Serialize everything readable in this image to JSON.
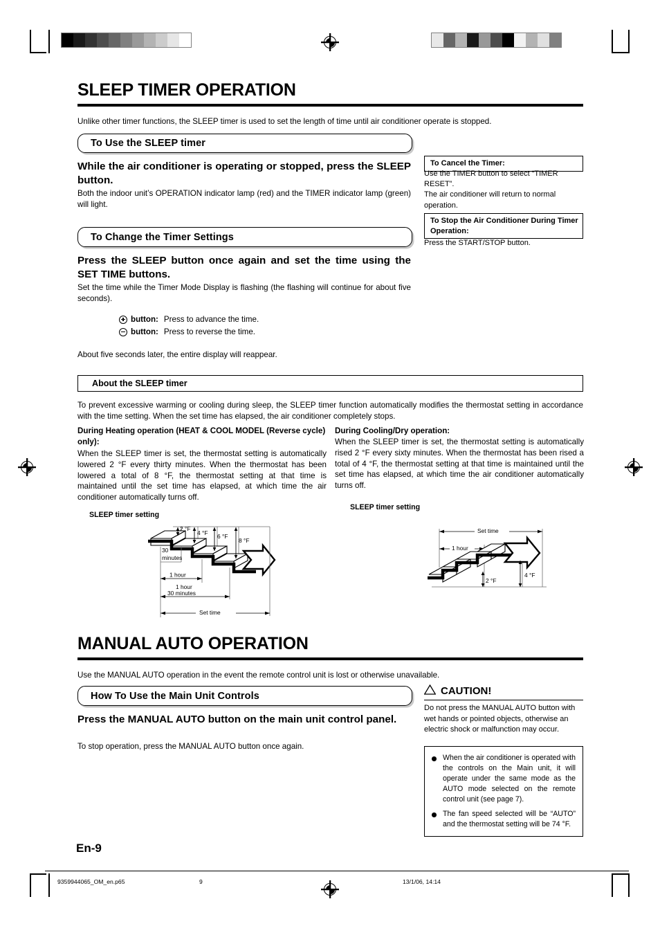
{
  "printer_marks": {
    "colorbar_left": [
      "#000000",
      "#1a1a1a",
      "#333333",
      "#4d4d4d",
      "#666666",
      "#808080",
      "#999999",
      "#b3b3b3",
      "#cccccc",
      "#e6e6e6",
      "#ffffff"
    ],
    "colorbar_right": [
      "#e8e8e8",
      "#666666",
      "#b3b3b3",
      "#1a1a1a",
      "#999999",
      "#4d4d4d",
      "#000000",
      "#f2f2f2",
      "#b3b3b3",
      "#e0e0e0",
      "#808080"
    ]
  },
  "section1": {
    "title": "SLEEP TIMER OPERATION",
    "intro": "Unlike other timer functions, the SLEEP timer is used to set the length of time until air conditioner operate is stopped.",
    "bar1_label": "To Use the SLEEP timer",
    "lead1": "While the air conditioner is operating or stopped, press the SLEEP button.",
    "body1": "Both the indoor unit’s OPERATION indicator lamp (red) and the TIMER indicator lamp (green) will light.",
    "bar2_label": "To Change the Timer Settings",
    "lead2": "Press the SLEEP button once again and set the time using the SET TIME buttons.",
    "body2": "Set the time while the Timer Mode Display is flashing (the flashing will continue for about five seconds).",
    "plus_button_label": "button:",
    "plus_button_desc": "Press to advance the time.",
    "minus_button_label": "button:",
    "minus_button_desc": "Press to reverse the time.",
    "body3": "About five seconds later, the entire display will reappear."
  },
  "sideboxes": [
    {
      "title": "To Cancel the Timer:",
      "body": "Use the TIMER button to select “TIMER RESET”.\nThe air conditioner will return to normal operation."
    },
    {
      "title": "To Stop the Air Conditioner During Timer Operation:",
      "body": "Press the START/STOP button."
    }
  ],
  "about": {
    "bar_label": "About the SLEEP timer",
    "intro": "To prevent excessive warming or cooling during sleep, the SLEEP timer function automatically modifies the thermostat setting in accordance with the time setting. When the set time has elapsed, the air conditioner completely stops.",
    "left_heading": "During Heating operation (HEAT & COOL MODEL (Reverse cycle) only):",
    "left_body": "When the SLEEP timer is set, the thermostat setting is automatically lowered 2 °F every thirty minutes. When the thermostat has been lowered a total of 8 °F, the thermostat setting at that time is maintained until the set time has elapsed, at which time the air conditioner automatically turns off.",
    "right_heading": "During Cooling/Dry operation:",
    "right_body": "When the SLEEP timer is set, the thermostat setting is automatically rised 2 °F every sixty minutes. When the thermostat has been rised a total of 4 °F, the thermostat setting at that time is maintained until the set time has elapsed, at which time the air conditioner automatically turns off."
  },
  "diagram_heating": {
    "caption": "SLEEP timer setting",
    "step_labels": [
      "2 °F",
      "4 °F",
      "6 °F",
      "8 °F"
    ],
    "interval_label": "30\nminutes",
    "interval_label_line1": "30",
    "interval_label_line2": "minutes",
    "dim1": "1 hour",
    "dim2_line1": "1 hour",
    "dim2_line2": "30 minutes",
    "dim3": "Set time"
  },
  "diagram_cooling": {
    "caption": "SLEEP timer setting",
    "dim_top": "Set time",
    "dim_mid": "1 hour",
    "step_labels": [
      "2 °F",
      "4 °F"
    ]
  },
  "section2": {
    "title": "MANUAL AUTO OPERATION",
    "intro": "Use the MANUAL AUTO operation in the event the remote control unit is lost or otherwise unavailable.",
    "bar_label": "How To Use the Main Unit Controls",
    "lead": "Press the MANUAL AUTO button on the main unit control panel.",
    "body": "To stop operation, press the MANUAL AUTO button once again."
  },
  "caution": {
    "heading": "CAUTION!",
    "body": "Do not press the MANUAL AUTO button with wet hands or pointed objects, otherwise an electric shock or malfunction may occur.",
    "notices": [
      "When the air conditioner is operated with the controls on the Main unit, it will operate under the same mode as the AUTO mode selected on the remote control unit (see page 7).",
      "The fan speed selected will be “AUTO” and the thermostat setting will be 74 °F."
    ]
  },
  "footer": {
    "page_label": "En-9",
    "file_name": "9359944065_OM_en.p65",
    "page_number": "9",
    "timestamp": "13/1/06, 14:14"
  }
}
